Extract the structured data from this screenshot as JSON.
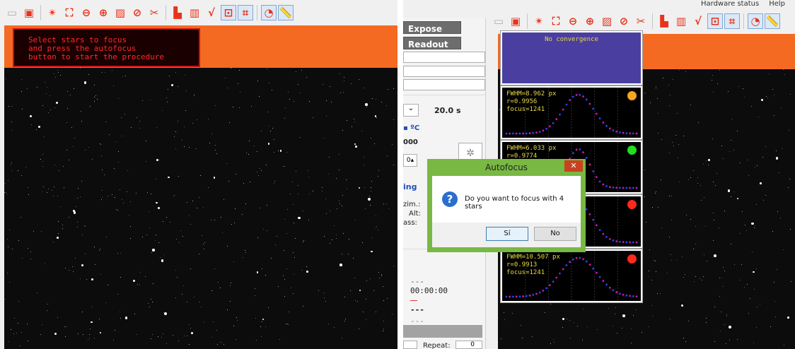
{
  "left_toolbar": {
    "icons": [
      "new-icon",
      "save-icon",
      "stars-icon",
      "fit-screen-icon",
      "zoom-out-icon",
      "zoom-in-icon",
      "image-icon",
      "no-entry-icon",
      "cut-icon",
      "histogram-icon",
      "bar-chart-icon",
      "sqrt-icon",
      "focus-target-icon",
      "crop-icon",
      "reticle-icon",
      "ruler-icon"
    ]
  },
  "focus_prompt": "Select stars to focus\nand press the autofocus\nbutton to start the procedure",
  "right_menu": {
    "hardware_status": "Hardware status",
    "help": "Help"
  },
  "control_panel": {
    "expose_label": "Expose",
    "readout_label": "Readout",
    "exposure_time": "20.0 s",
    "temp_unit": "ºC",
    "value_1": "000",
    "spinner_value": "0",
    "section_heading": "ing",
    "row_labels": [
      "zim.:",
      "Alt:",
      "ass:"
    ],
    "dash_1": "---",
    "time_display": "00:00:00",
    "dash_2": "---",
    "dash_3": "---",
    "repeat_label": "Repeat:",
    "repeat_value": "0"
  },
  "graphs": {
    "convergence_text": "No convergence",
    "panels": [
      {
        "fwhm": "FWHM=8.962 px",
        "r": "r=0.9956",
        "focus": "focus=1241",
        "status_color": "#f5a623"
      },
      {
        "fwhm": "FWHM=6.033 px",
        "r": "r=0.9774",
        "focus": "",
        "status_color": "#22dd22"
      },
      {
        "fwhm": "",
        "r": "",
        "focus": "",
        "status_color": "#ff2a1a"
      },
      {
        "fwhm": "FWHM=10.507 px",
        "r": "r=0.9913",
        "focus": "focus=1241",
        "status_color": "#ff2a1a"
      }
    ]
  },
  "dialog": {
    "title": "Autofocus",
    "close": "✕",
    "message": "Do you want to focus with 4 stars",
    "yes": "Sí",
    "no": "No"
  },
  "colors": {
    "accent": "#e8331c",
    "orange": "#f56a22",
    "dialog_frame": "#78b843"
  }
}
